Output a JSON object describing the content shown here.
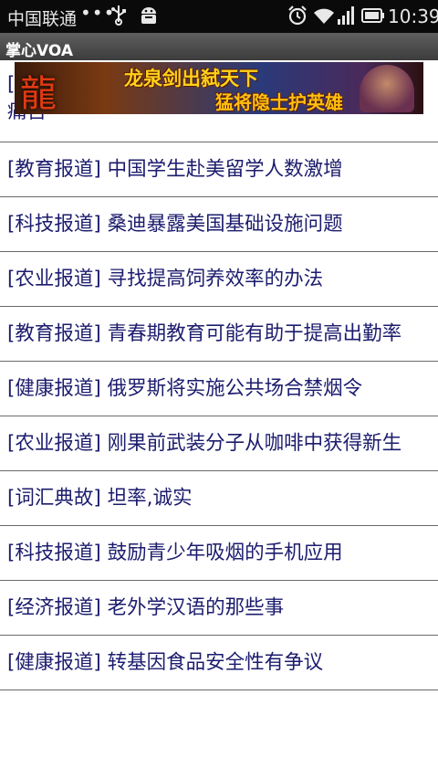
{
  "status_bar": {
    "carrier": "中国联通",
    "dots": "•••",
    "time": "10:39"
  },
  "app": {
    "title": "掌心VOA"
  },
  "ad": {
    "logo_text": "龍",
    "line1": "龙泉剑出弑天下",
    "line2": "猛将隐士护英雄"
  },
  "articles": [
    "[健康报道] 研究显示运动有助于缓解老年患者的痛苦",
    "[教育报道] 中国学生赴美留学人数激增",
    "[科技报道] 桑迪暴露美国基础设施问题",
    "[农业报道] 寻找提高饲养效率的办法",
    "[教育报道] 青春期教育可能有助于提高出勤率",
    "[健康报道] 俄罗斯将实施公共场合禁烟令",
    "[农业报道] 刚果前武装分子从咖啡中获得新生",
    "[词汇典故] 坦率,诚实",
    "[科技报道] 鼓励青少年吸烟的手机应用",
    "[经济报道] 老外学汉语的那些事",
    "[健康报道] 转基因食品安全性有争议"
  ]
}
